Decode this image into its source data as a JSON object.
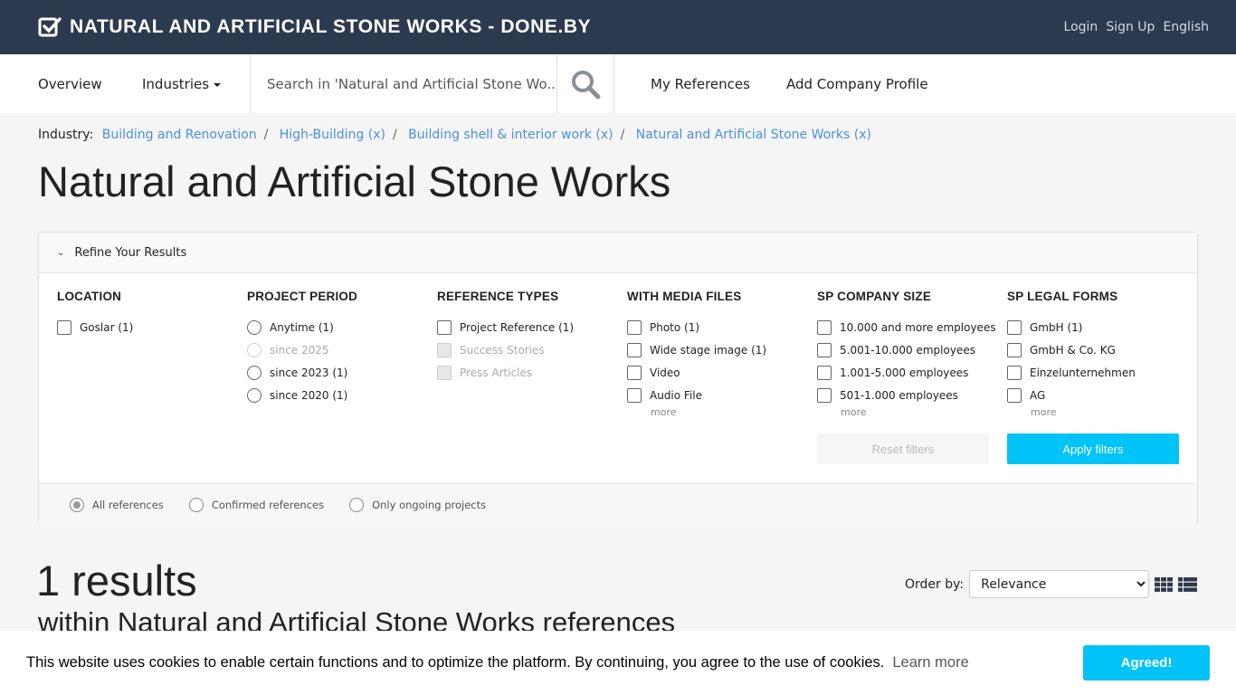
{
  "header": {
    "brand": "NATURAL AND ARTIFICIAL STONE WORKS - DONE.BY",
    "links": [
      "Login",
      "Sign Up",
      "English"
    ]
  },
  "nav": {
    "overview": "Overview",
    "industries": "Industries",
    "search_placeholder": "Search in 'Natural and Artificial Stone Wo...",
    "my_references": "My References",
    "add_company": "Add Company Profile"
  },
  "breadcrumb": {
    "label": "Industry:",
    "items": [
      "Building and Renovation",
      "High-Building (x)",
      "Building shell & interior work (x)",
      "Natural and Artificial Stone Works (x)"
    ],
    "separator": "/"
  },
  "page_title": "Natural and Artificial Stone Works",
  "filters": {
    "heading": "Refine Your Results",
    "columns": [
      {
        "title": "LOCATION",
        "options": [
          "Goslar (1)"
        ]
      },
      {
        "title": "PROJECT PERIOD",
        "options": [
          "Anytime (1)",
          "since 2025",
          "since 2023 (1)",
          "since 2020 (1)"
        ]
      },
      {
        "title": "REFERENCE TYPES",
        "options": [
          "Project Reference (1)",
          "Success Stories",
          "Press Articles"
        ]
      },
      {
        "title": "WITH MEDIA FILES",
        "options": [
          "Photo (1)",
          "Wide stage image (1)",
          "Video",
          "Audio File"
        ],
        "more": "more"
      },
      {
        "title": "SP COMPANY SIZE",
        "options": [
          "10.000 and more employees",
          "5.001-10.000 employees",
          "1.001-5.000 employees",
          "501-1.000 employees"
        ],
        "more": "more"
      },
      {
        "title": "SP LEGAL FORMS",
        "options": [
          "GmbH (1)",
          "GmbH & Co. KG",
          "Einzelunternehmen",
          "AG"
        ],
        "more": "more"
      }
    ],
    "reset": "Reset filters",
    "apply": "Apply filters",
    "scope": [
      "All references",
      "Confirmed references",
      "Only ongoing projects"
    ]
  },
  "results": {
    "count": "1 results",
    "subtitle": "within Natural and Artificial Stone Works references",
    "order_label": "Order by:",
    "order_value": "Relevance"
  },
  "cookie": {
    "text": "This website uses cookies to enable certain functions and to optimize the platform. By continuing, you agree to the use of cookies.",
    "learn_more": "Learn more",
    "button": "Agreed!"
  },
  "colors": {
    "header_bg": "#2c3a4f",
    "accent": "#00c3f8",
    "link": "#4a90e2"
  }
}
